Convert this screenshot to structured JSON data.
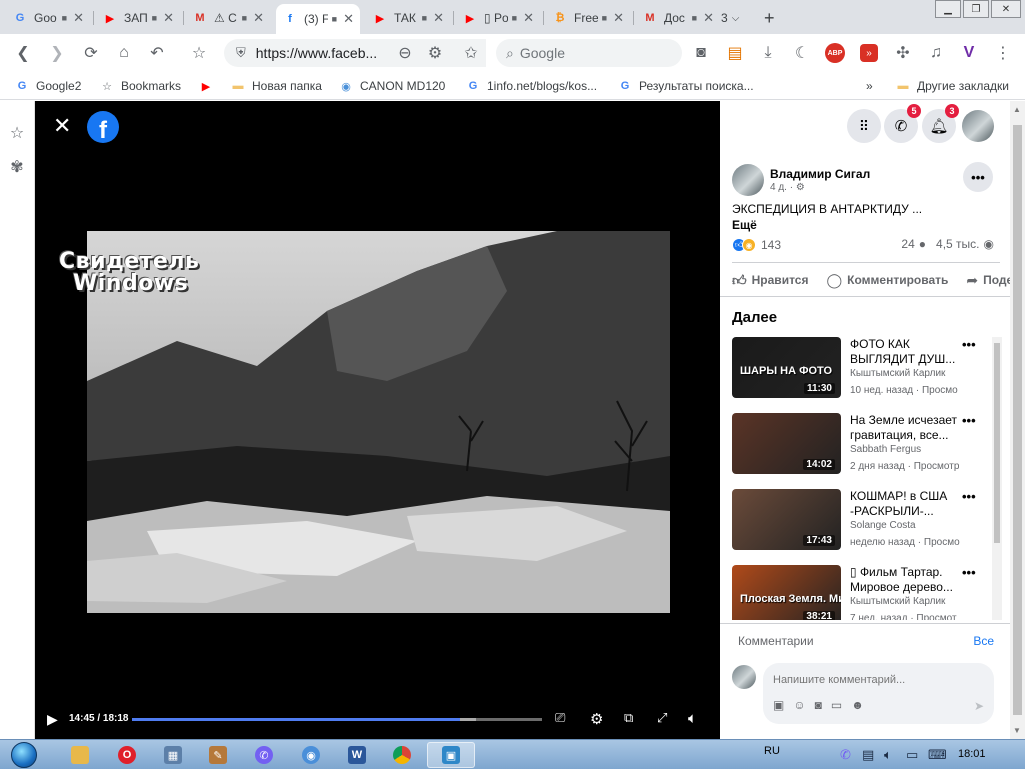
{
  "tabs": [
    {
      "title": "Goo",
      "icon": "google-icon",
      "color": "#4285f4",
      "letter": "G"
    },
    {
      "title": "ЗАП",
      "icon": "youtube-icon",
      "color": "#ff0000",
      "letter": "▶"
    },
    {
      "title": "⚠ С",
      "icon": "gmail-icon",
      "color": "#d93025",
      "letter": "M"
    },
    {
      "title": "(3) F",
      "icon": "facebook-icon",
      "color": "#1877f2",
      "letter": "f"
    },
    {
      "title": "ТАК",
      "icon": "youtube-icon",
      "color": "#ff0000",
      "letter": "▶"
    },
    {
      "title": "▯ Po",
      "icon": "youtube-icon",
      "color": "#ff0000",
      "letter": "▶"
    },
    {
      "title": "Free",
      "icon": "bitcoin-icon",
      "color": "#f7931a",
      "letter": "₿"
    },
    {
      "title": "Дос",
      "icon": "gmail-icon",
      "color": "#d93025",
      "letter": "M"
    }
  ],
  "tab_overflow": "3",
  "address": {
    "url": "https://www.faceb..."
  },
  "search": {
    "placeholder": "Google"
  },
  "bookmarks": [
    {
      "label": "Google2",
      "icon": "google-icon",
      "color": "#4285f4",
      "letter": "G"
    },
    {
      "label": "Bookmarks",
      "icon": "star-icon",
      "color": "#5f6368",
      "letter": "☆"
    },
    {
      "label": "",
      "icon": "youtube-icon",
      "color": "#ff0000",
      "letter": "▶"
    },
    {
      "label": "Новая папка",
      "icon": "folder-icon",
      "color": "#f2c46d",
      "letter": "▬"
    },
    {
      "label": "CANON MD120",
      "icon": "canon-icon",
      "color": "#4a90d9",
      "letter": "◉"
    },
    {
      "label": "1info.net/blogs/kos...",
      "icon": "google-icon",
      "color": "#4285f4",
      "letter": "G"
    },
    {
      "label": "Результаты поиска...",
      "icon": "google-icon",
      "color": "#4285f4",
      "letter": "G"
    }
  ],
  "bookmarks_other": "Другие закладки",
  "video": {
    "watermark_line1": "Свидетель",
    "watermark_line2": "Windows",
    "time": "14:45 / 18:18",
    "progress": 0.8,
    "buffered": 0.84
  },
  "header": {
    "messenger_badge": "5",
    "notifications_badge": "3"
  },
  "post": {
    "author": "Владимир Сигал",
    "meta": "4 д. · ⚙",
    "text": "ЭКСПЕДИЦИЯ В АНТАРКТИДУ ...",
    "more": "Ещё",
    "reactions_count": "143",
    "comments_count": "24",
    "views": "4,5 тыс.",
    "actions": {
      "like": "Нравится",
      "comment": "Комментировать",
      "share": "Поде"
    }
  },
  "next": {
    "title": "Далее",
    "videos": [
      {
        "title": "ФОТО КАК ВЫГЛЯДИТ ДУШ...",
        "channel": "Кыштымский Карлик",
        "meta": "10 нед. назад · Просмо",
        "duration": "11:30",
        "thumb_text": "ШАРЫ НА ФОТО",
        "thumb_color": "#1a1a1a"
      },
      {
        "title": "На Земле исчезает гравитация, все...",
        "channel": "Sabbath Fergus",
        "meta": "2 дня назад · Просмотр",
        "duration": "14:02",
        "thumb_text": "",
        "thumb_color": "#5b3426"
      },
      {
        "title": "КОШМАР! в США -РАСКРЫЛИ-...",
        "channel": "Solange Costa",
        "meta": "неделю назад · Просмо",
        "duration": "17:43",
        "thumb_text": "",
        "thumb_color": "#6b4b3a"
      },
      {
        "title": "▯ Фильм Тартар. Мировое дерево...",
        "channel": "Кыштымский Карлик",
        "meta": "7 нед. назад · Просмот",
        "duration": "38:21",
        "thumb_text": "Плоская Земля. Мировое Древо",
        "thumb_color": "#b04a1a"
      }
    ]
  },
  "comments": {
    "label": "Комментарии",
    "all": "Все",
    "placeholder": "Напишите комментарий..."
  },
  "taskbar": {
    "lang": "RU",
    "clock": "18:01"
  }
}
